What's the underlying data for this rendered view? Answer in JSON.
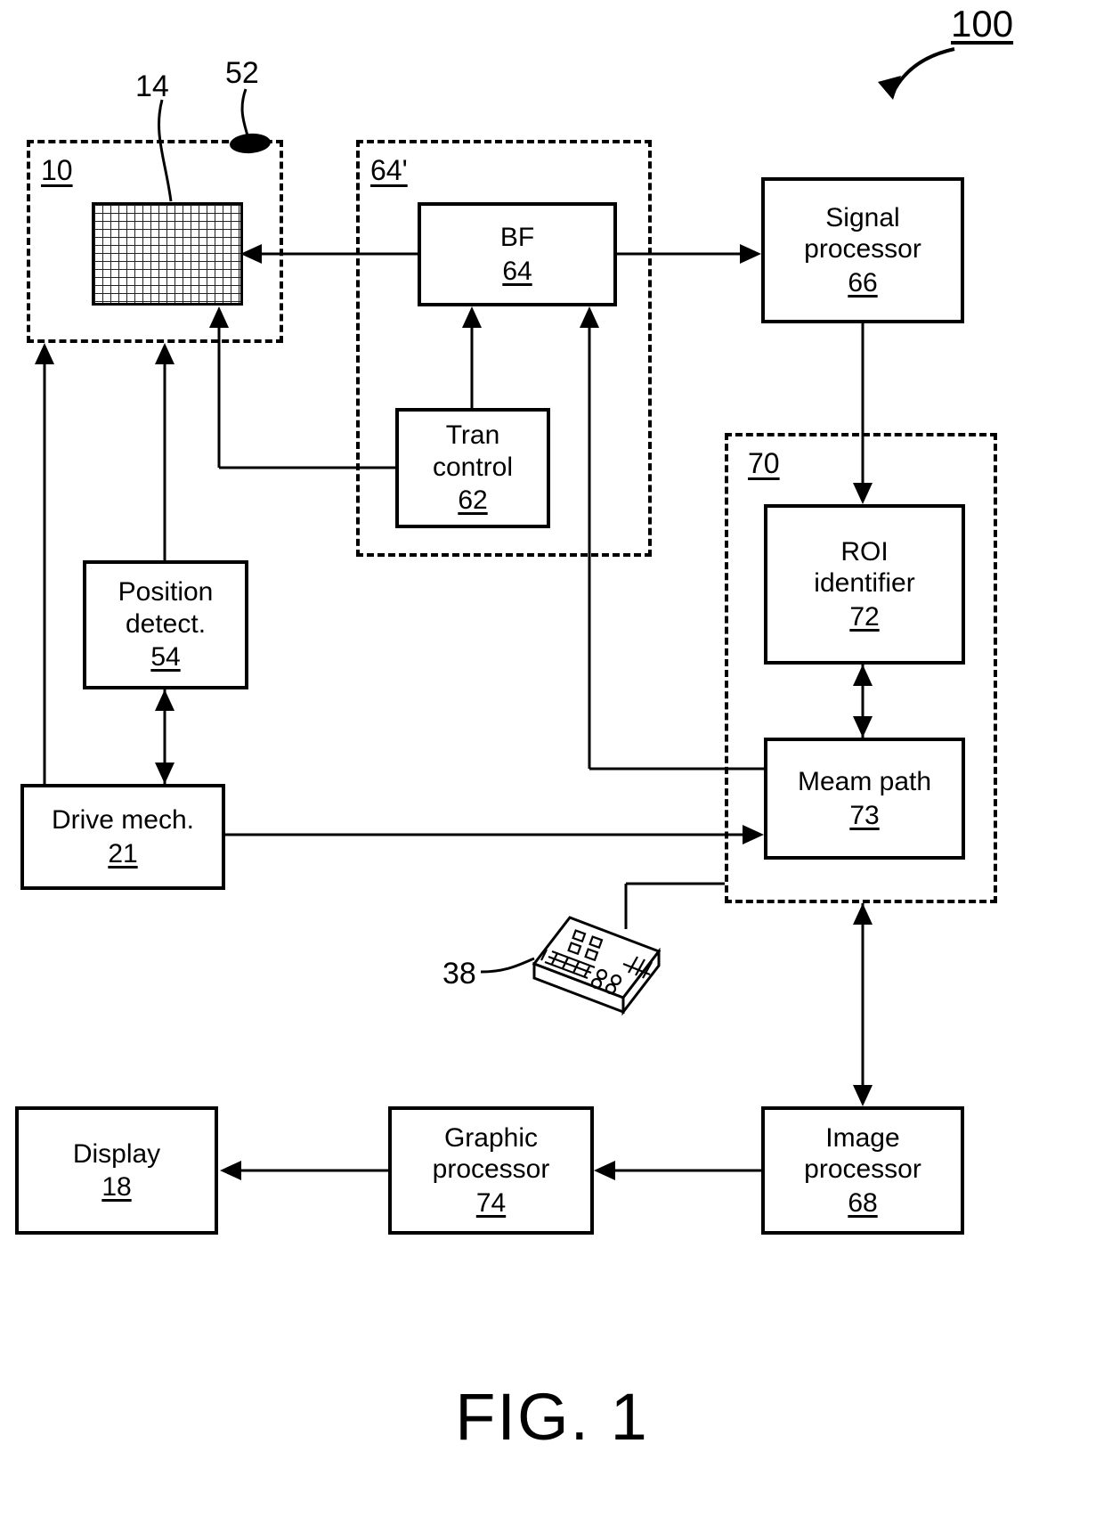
{
  "figure": {
    "caption": "FIG. 1",
    "system_label": "100"
  },
  "groups": [
    {
      "id": "probe-group",
      "label": "10"
    },
    {
      "id": "beamformer-group",
      "label": "64'"
    },
    {
      "id": "roi-group",
      "label": "70"
    }
  ],
  "callouts": [
    {
      "id": "array-callout",
      "label": "14"
    },
    {
      "id": "marker-callout",
      "label": "52"
    },
    {
      "id": "console-callout",
      "label": "38"
    }
  ],
  "blocks": [
    {
      "id": "bf",
      "line1": "BF",
      "line2": "",
      "num": "64"
    },
    {
      "id": "tran-control",
      "line1": "Tran",
      "line2": "control",
      "num": "62"
    },
    {
      "id": "signal-processor",
      "line1": "Signal",
      "line2": "processor",
      "num": "66"
    },
    {
      "id": "roi-identifier",
      "line1": "ROI",
      "line2": "identifier",
      "num": "72"
    },
    {
      "id": "meam-path",
      "line1": "Meam path",
      "line2": "",
      "num": "73"
    },
    {
      "id": "position-detect",
      "line1": "Position",
      "line2": "detect.",
      "num": "54"
    },
    {
      "id": "drive-mech",
      "line1": "Drive mech.",
      "line2": "",
      "num": "21"
    },
    {
      "id": "display",
      "line1": "Display",
      "line2": "",
      "num": "18"
    },
    {
      "id": "graphic-processor",
      "line1": "Graphic",
      "line2": "processor",
      "num": "74"
    },
    {
      "id": "image-processor",
      "line1": "Image",
      "line2": "processor",
      "num": "68"
    }
  ],
  "icons": {
    "transducer_array": "transducer-array-icon",
    "probe_marker": "probe-marker-icon",
    "user_console": "keyboard-console-icon"
  },
  "colors": {
    "ink": "#000000",
    "background": "#ffffff"
  }
}
